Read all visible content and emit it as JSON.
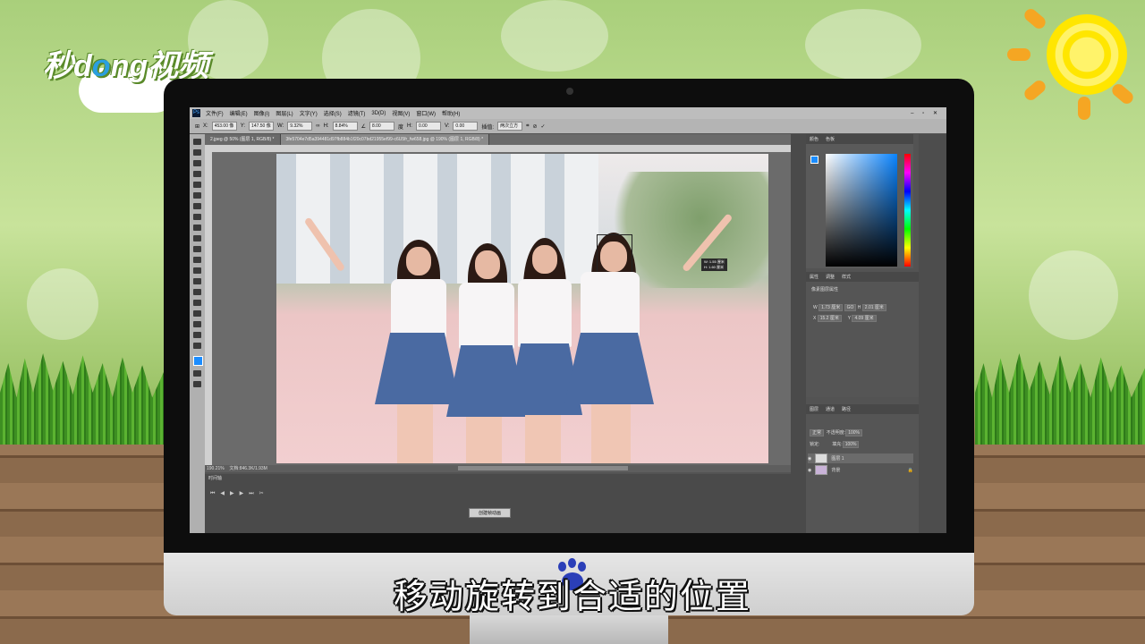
{
  "brand": {
    "logo_pre": "秒d",
    "logo_o": "o",
    "logo_post": "ng视频"
  },
  "subtitle": "移动旋转到合适的位置",
  "app": {
    "menu": [
      "文件(F)",
      "编辑(E)",
      "图像(I)",
      "图层(L)",
      "文字(Y)",
      "选择(S)",
      "滤镜(T)",
      "3D(D)",
      "视图(V)",
      "窗口(W)",
      "帮助(H)"
    ],
    "options": {
      "x_label": "X:",
      "x": "453.00 像",
      "y_label": "Y:",
      "y": "147.50 像",
      "w_label": "W:",
      "w": "9.32%",
      "h_label": "H:",
      "h": "8.84%",
      "angle": "8.00",
      "angle_unit": "度",
      "hskew_label": "H:",
      "hskew": "0.00",
      "vskew_label": "V:",
      "vskew": "0.00",
      "interp_label": "插值:",
      "interp": "两次立方"
    },
    "tabs": [
      "2.jpeg @ 50% (图层 1, RGB/8) *",
      "3fe5704e7d5a394481d97fb884b1f20c07bd21955ef99-c6U5fr_fw658.jpg @ 190% (图层 1, RGB/8) *"
    ],
    "transform_tip": {
      "w": "W: 1.55 厘米",
      "h": "H: 1.60 厘米"
    },
    "status": {
      "zoom": "190.21%",
      "doc": "文档:846.3K/1.93M"
    },
    "timeline": {
      "title": "时间轴",
      "create_btn": "创建帧动画"
    },
    "color_panel": {
      "tabs": [
        "颜色",
        "色板"
      ]
    },
    "properties_panel": {
      "tabs": [
        "属性",
        "调整",
        "样式"
      ],
      "title": "像素图层属性",
      "w": "1.73 厘米",
      "h": "2.01 厘米",
      "x": "15.2 厘米",
      "y": "4.09 厘米",
      "link": "GO"
    },
    "layers_panel": {
      "tabs": [
        "图层",
        "通道",
        "路径"
      ],
      "blend": "正常",
      "opacity_label": "不透明度:",
      "opacity": "100%",
      "lock_label": "锁定:",
      "fill_label": "填充:",
      "fill": "100%",
      "layers": [
        {
          "name": "图层 1",
          "selected": true
        },
        {
          "name": "背景",
          "selected": false
        }
      ]
    }
  }
}
